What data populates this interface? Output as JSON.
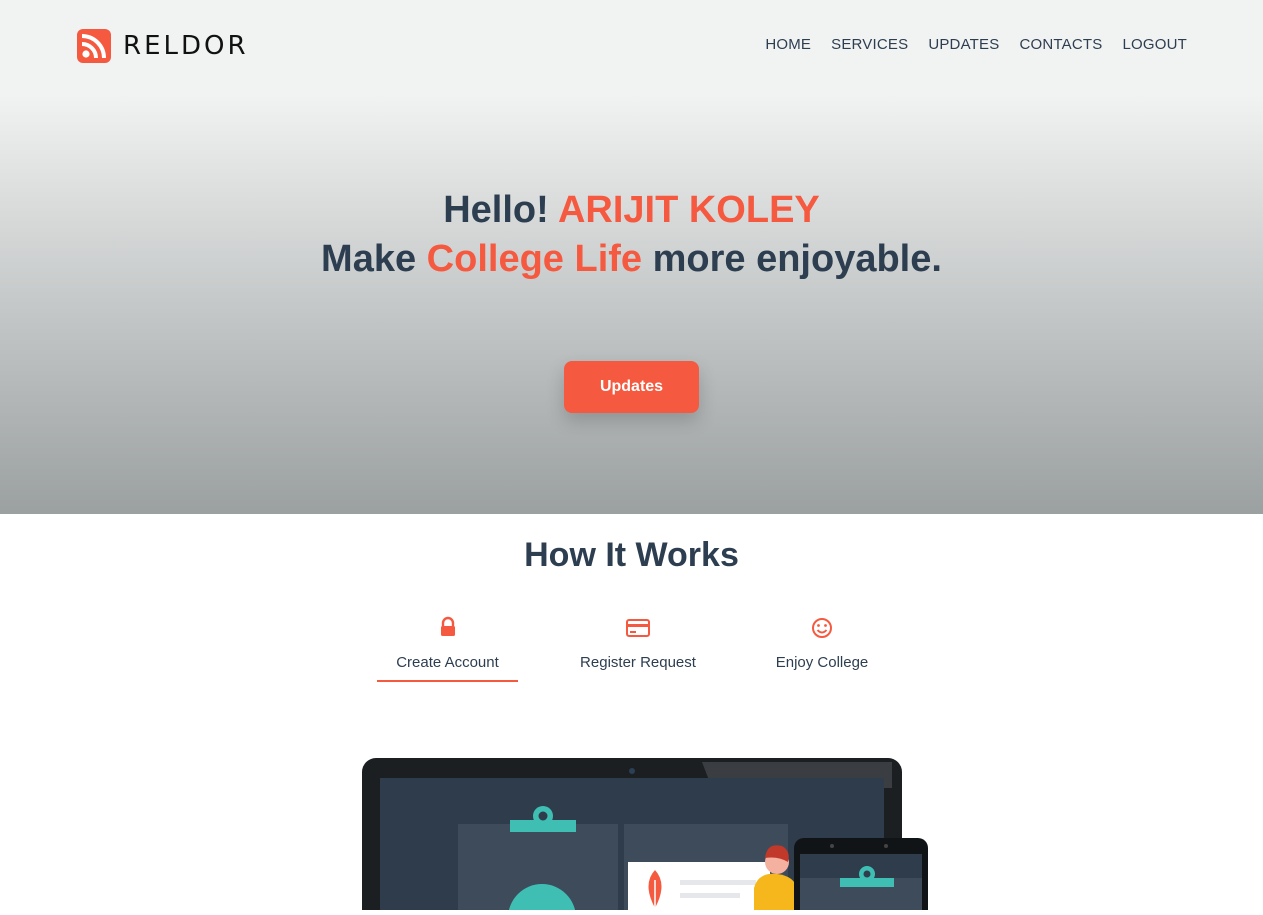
{
  "brand": {
    "name": "RELDOR",
    "icon": "rss-icon",
    "accent": "#f55a40"
  },
  "nav": [
    "HOME",
    "SERVICES",
    "UPDATES",
    "CONTACTS",
    "LOGOUT"
  ],
  "hero": {
    "greeting": "Hello!",
    "user_name": "ARIJIT KOLEY",
    "line2_start": "Make",
    "line2_accent": "College Life",
    "line2_end": "more enjoyable.",
    "button_label": "Updates"
  },
  "how_it_works": {
    "title": "How It Works",
    "steps": [
      {
        "label": "Create Account",
        "icon": "lock-icon",
        "active": true
      },
      {
        "label": "Register Request",
        "icon": "credit-card-icon",
        "active": false
      },
      {
        "label": "Enjoy College",
        "icon": "smiley-icon",
        "active": false
      }
    ]
  },
  "colors": {
    "text": "#2d3e50",
    "accent": "#f55a40",
    "teal": "#3fbfb3"
  }
}
